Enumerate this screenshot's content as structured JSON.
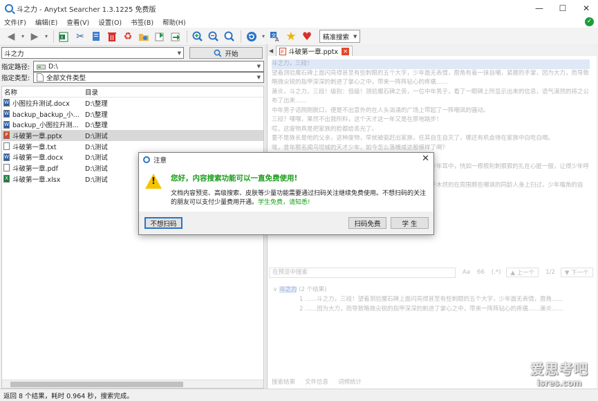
{
  "window": {
    "title": "斗之力 - Anytxt Searcher 1.3.1225 免费版",
    "controls": [
      "—",
      "☐",
      "✕"
    ]
  },
  "menu": [
    "文件(F)",
    "编辑(E)",
    "查看(V)",
    "设置(O)",
    "书签(B)",
    "帮助(H)"
  ],
  "toolbar": {
    "search_mode": "精准搜索",
    "icons": [
      "back-arrow-icon",
      "forward-arrow-icon",
      "excel-export-icon",
      "cut-icon",
      "copy-icon",
      "delete-icon",
      "recycle-icon",
      "folder-icon",
      "export-icon",
      "import-icon",
      "zoom-in-icon",
      "zoom-out-icon",
      "search-icon",
      "refresh-icon",
      "translate-icon",
      "star-icon",
      "heart-icon"
    ]
  },
  "search": {
    "query": "斗之力",
    "start_label": "开始"
  },
  "path": {
    "label": "指定路径:",
    "value": "D:\\"
  },
  "filetype": {
    "label": "指定类型:",
    "value": "全部文件类型"
  },
  "results": {
    "columns": [
      "名称",
      "目录"
    ],
    "rows": [
      {
        "name": "小图拉升测试.docx",
        "dir": "D:\\整理",
        "kind": "docx"
      },
      {
        "name": "backup_backup_小...",
        "dir": "D:\\整理",
        "kind": "docx"
      },
      {
        "name": "backup_小图拉升测...",
        "dir": "D:\\整理",
        "kind": "docx"
      },
      {
        "name": "斗破第一章.pptx",
        "dir": "D:\\测试",
        "kind": "pptx"
      },
      {
        "name": "斗破第一章.txt",
        "dir": "D:\\测试",
        "kind": "txt"
      },
      {
        "name": "斗破第一章.docx",
        "dir": "D:\\测试",
        "kind": "docx"
      },
      {
        "name": "斗破第一章.pdf",
        "dir": "D:\\测试",
        "kind": "pdf"
      },
      {
        "name": "斗破第一章.xlsx",
        "dir": "D:\\测试",
        "kind": "xlsx"
      }
    ],
    "selected_index": 3
  },
  "preview": {
    "tab_label": "斗破第一章.pptx",
    "lines": [
      "斗之力，三段！",
      "望着测验魔石碑上面闪亮得甚至有些刺眼的五个大字，少年面无表情，唇角有着一抹自嘲，紧握的手掌，因为大力，而导致略微尖锐的指甲深深的刺进了掌心之中，带来一阵阵钻心的疼痛……",
      "萧炎，斗之力，三段！级别：低级！测验魔石碑之旁，一位中年男子，看了一眼碑上所显示出来的信息，语气漠然的将之公布了出来……",
      "中年男子话刚刚脱口，便是不出意外的在人头汹涌的广场上带起了一阵嘲讽的骚动。",
      "三段？嘿嘿，果然不出我所料，这个天才这一年又是在原地踏步！",
      "哎，这废物真是把家族的脸都给丢光了。",
      "要不是族长是他的父亲，这种废物，早就被驱赶出家族，任其自生自灭了，哪还有机会待在家族中白吃白喝。",
      "唉，昔年那名闻乌坦城的天才少年，如今怎么落魄成这般模样了啊？",
      "谁知道呢，或许做了什么亏心事，惹得神灵降怒了吧……",
      "周围传来的不屑嘲笑以及惋惜轻叹，落在那如木桩待在原地的少年耳中，恍如一根根利刺狠狠的扎在心脏一般，让得少年呼吸微微急促。",
      "少年缓缓抬起头来，露出一张有些清秀的稚嫩脸庞，漆黑的眸子木然的在周围那些嘲讽的同龄人身上扫过，少年嘴角的自嘲，似乎变得更加苦涩了。"
    ],
    "find_placeholder": "在预览中搜索",
    "find_options": [
      "Aa",
      "66",
      "(.*)"
    ],
    "find_prev": "上一个",
    "find_page": "1/2",
    "find_next": "下一个",
    "match_header_term": "斗之力",
    "match_header_count": "(2 个结果)",
    "match_lines": [
      {
        "no": "1",
        "text": "……斗之力，三段！望着测验魔石碑上面闪亮得甚至有些刺眼的五个大字，少年面无表情，唇角……"
      },
      {
        "no": "2",
        "text": "……因为大力，而导致略微尖锐的指甲深深的刺进了掌心之中，带来一阵阵钻心的疼痛……萧炎……"
      }
    ],
    "bottom_tabs": [
      "搜索结果",
      "文件信息",
      "词频统计"
    ]
  },
  "status": {
    "text": "返回 8 个结果，耗时 0.964 秒，搜索完成。"
  },
  "watermark": {
    "big": "爱思考吧",
    "small": "isres.com"
  },
  "dialog": {
    "title": "注意",
    "heading": "您好，内容搜索功能可以一直免费使用!",
    "body": "文档内容预览、高级搜索、皮肤等少量功能需要通过扫码关注继续免费使用。不想扫码的关注的朋友可以支付少量费用开通。",
    "student_note": "学生免费，请知悉!",
    "btn_no_scan": "不想扫码",
    "btn_scan_free": "扫码免费",
    "btn_student": "学 生"
  },
  "colors": {
    "accent": "#2b73c7",
    "green": "#1a9c1a",
    "warning": "#f5c400",
    "close_red": "#e14a2b"
  }
}
